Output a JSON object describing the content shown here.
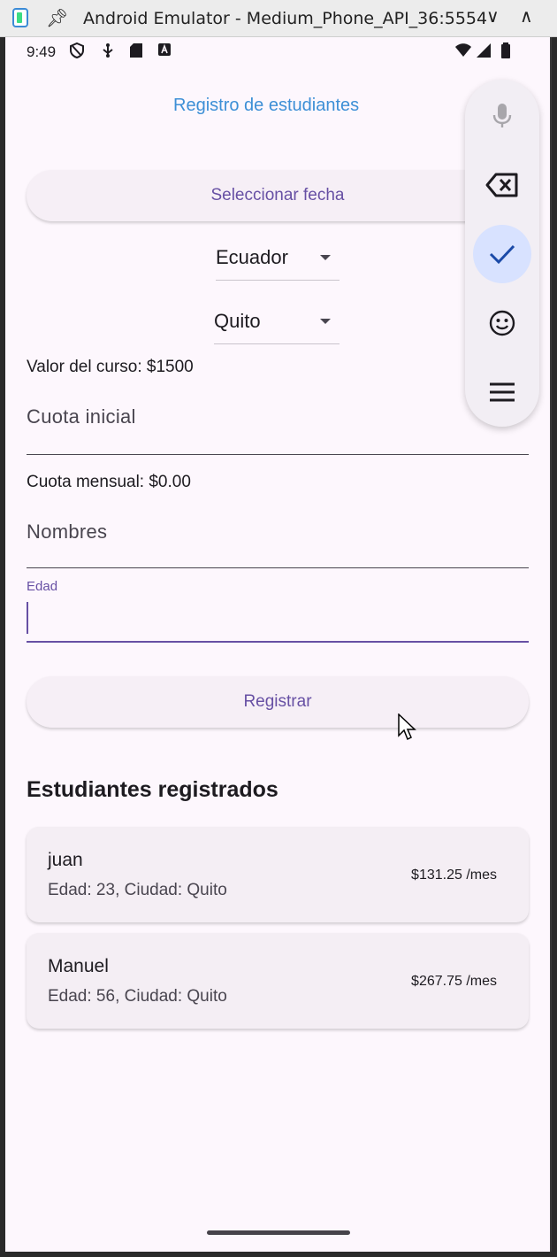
{
  "window": {
    "title": "Android Emulator - Medium_Phone_API_36:5554",
    "minimize_glyph": "∨",
    "maximize_glyph": "∧"
  },
  "status_bar": {
    "time": "9:49",
    "left_icons": [
      "shield-icon",
      "usb-icon",
      "sd-card-icon",
      "keyboard-icon"
    ],
    "right_icons": [
      "wifi-icon",
      "signal-icon",
      "battery-icon"
    ]
  },
  "app": {
    "title": "Registro de estudiantes",
    "select_date_label": "Seleccionar fecha",
    "country_dropdown": {
      "value": "Ecuador"
    },
    "city_dropdown": {
      "value": "Quito"
    },
    "course_value_text": "Valor del curso: $1500",
    "down_payment_field": {
      "placeholder": "Cuota inicial",
      "value": ""
    },
    "monthly_fee_text": "Cuota mensual: $0.00",
    "names_field": {
      "placeholder": "Nombres",
      "value": ""
    },
    "age_field": {
      "label": "Edad",
      "value": ""
    },
    "register_label": "Registrar",
    "section_title": "Estudiantes registrados",
    "students": [
      {
        "name": "juan",
        "details": "Edad: 23, Ciudad: Quito",
        "fee": "$131.25 /mes"
      },
      {
        "name": "Manuel",
        "details": "Edad: 56, Ciudad: Quito",
        "fee": "$267.75 /mes"
      }
    ]
  },
  "keyboard_toolbar": {
    "buttons": [
      "mic-icon",
      "backspace-icon",
      "check-icon",
      "emoji-icon",
      "menu-icon"
    ],
    "active": "check-icon"
  },
  "colors": {
    "accent": "#6750a4",
    "title_blue": "#3d8fd6",
    "background": "#fdf7fd",
    "check_active_bg": "#d8e2ff"
  }
}
